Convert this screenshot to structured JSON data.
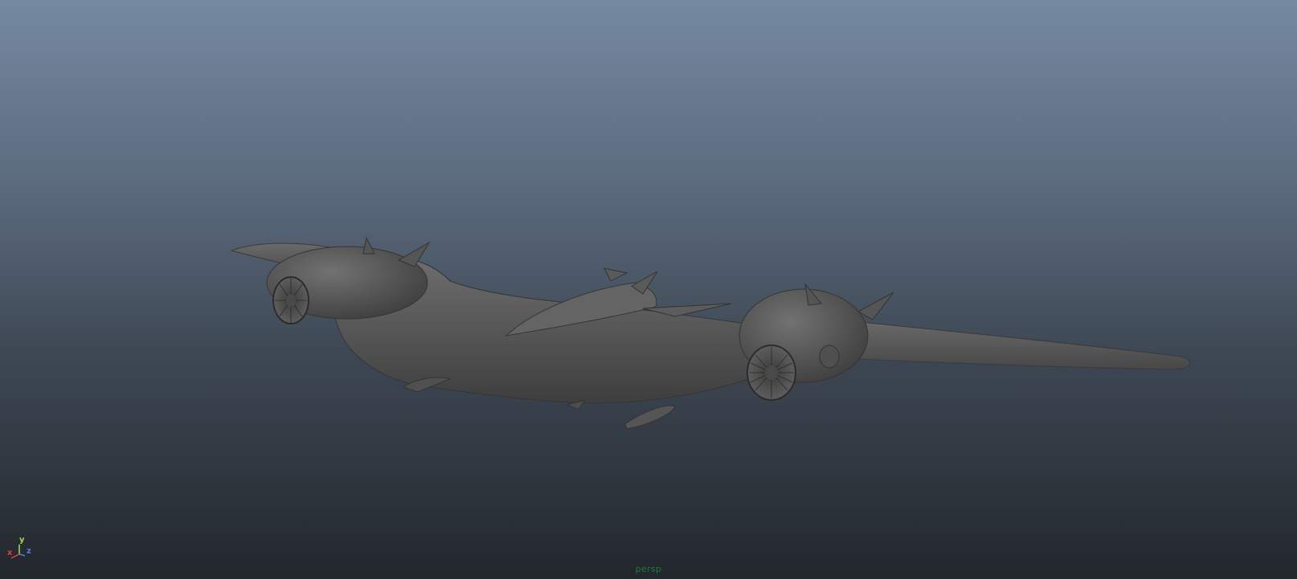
{
  "viewport": {
    "camera_name": "persp",
    "background_top": "#7589a1",
    "background_bottom": "#22272c"
  },
  "model": {
    "icon": "flying-wing-aircraft-model",
    "shading_color": "#5a5a5a"
  },
  "axis_gizmo": {
    "x_label": "x",
    "y_label": "y",
    "z_label": "z",
    "x_color": "#e04040",
    "y_color": "#9fe04a",
    "z_color": "#4f7fe0"
  },
  "camera_label_color": "#1f7a3a"
}
